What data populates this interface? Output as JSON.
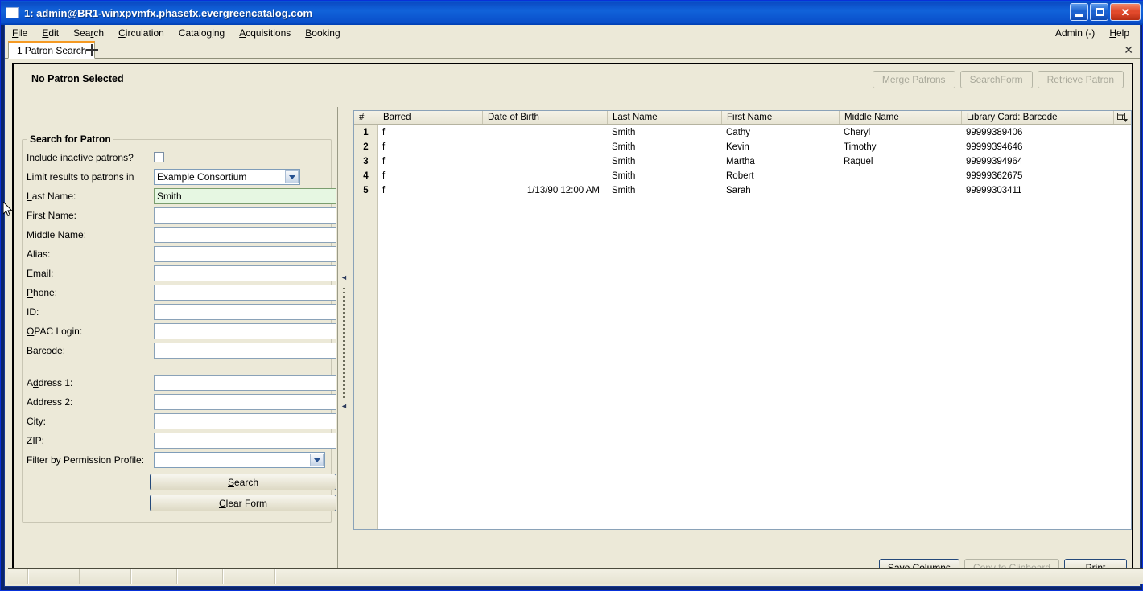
{
  "window": {
    "title": "1: admin@BR1-winxpvmfx.phasefx.evergreencatalog.com",
    "minimize_label": "Minimize",
    "maximize_label": "Maximize",
    "close_label": "✕"
  },
  "menubar": {
    "items": [
      {
        "label": "File",
        "accel": "F"
      },
      {
        "label": "Edit",
        "accel": "E"
      },
      {
        "label": "Search",
        "accel": "r"
      },
      {
        "label": "Circulation",
        "accel": "C"
      },
      {
        "label": "Cataloging",
        "accel": "g"
      },
      {
        "label": "Acquisitions",
        "accel": "A"
      },
      {
        "label": "Booking",
        "accel": "B"
      }
    ],
    "right_items": [
      {
        "label": "Admin (-)"
      },
      {
        "label": "Help"
      }
    ]
  },
  "tabs": {
    "active": {
      "number": "1",
      "label": "Patron Search"
    },
    "add_label": "+",
    "close_label": "✕"
  },
  "patron_header": {
    "status": "No Patron Selected",
    "buttons": [
      {
        "label": "Merge Patrons",
        "enabled": false
      },
      {
        "label": "Search Form",
        "enabled": false
      },
      {
        "label": "Retrieve Patron",
        "enabled": false
      }
    ]
  },
  "search_form": {
    "legend": "Search for Patron",
    "include_inactive_label": "Include inactive patrons?",
    "include_inactive_checked": false,
    "limit_results_label": "Limit results to patrons in",
    "limit_results_value": "Example Consortium",
    "fields": [
      {
        "label": "Last Name:",
        "value": "Smith",
        "focused": true
      },
      {
        "label": "First Name:",
        "value": "",
        "focused": false
      },
      {
        "label": "Middle Name:",
        "value": "",
        "focused": false
      },
      {
        "label": "Alias:",
        "value": "",
        "focused": false
      },
      {
        "label": "Email:",
        "value": "",
        "focused": false
      },
      {
        "label": "Phone:",
        "value": "",
        "focused": false
      },
      {
        "label": "ID:",
        "value": "",
        "focused": false
      },
      {
        "label": "OPAC Login:",
        "value": "",
        "focused": false
      },
      {
        "label": "Barcode:",
        "value": "",
        "focused": false
      }
    ],
    "address_fields": [
      {
        "label": "Address 1:",
        "value": ""
      },
      {
        "label": "Address 2:",
        "value": ""
      },
      {
        "label": "City:",
        "value": ""
      },
      {
        "label": "ZIP:",
        "value": ""
      }
    ],
    "permission_profile_label": "Filter by Permission Profile:",
    "permission_profile_value": "",
    "search_button": "Search",
    "clear_button": "Clear Form"
  },
  "results": {
    "columns": [
      {
        "key": "num",
        "label": "#"
      },
      {
        "key": "barred",
        "label": "Barred"
      },
      {
        "key": "dob",
        "label": "Date of Birth"
      },
      {
        "key": "last",
        "label": "Last Name"
      },
      {
        "key": "first",
        "label": "First Name"
      },
      {
        "key": "middle",
        "label": "Middle Name"
      },
      {
        "key": "barcode",
        "label": "Library Card: Barcode"
      }
    ],
    "rows": [
      {
        "num": "1",
        "barred": "f",
        "dob": "",
        "last": "Smith",
        "first": "Cathy",
        "middle": "Cheryl",
        "barcode": "99999389406"
      },
      {
        "num": "2",
        "barred": "f",
        "dob": "",
        "last": "Smith",
        "first": "Kevin",
        "middle": "Timothy",
        "barcode": "99999394646"
      },
      {
        "num": "3",
        "barred": "f",
        "dob": "",
        "last": "Smith",
        "first": "Martha",
        "middle": "Raquel",
        "barcode": "99999394964"
      },
      {
        "num": "4",
        "barred": "f",
        "dob": "",
        "last": "Smith",
        "first": "Robert",
        "middle": "",
        "barcode": "99999362675"
      },
      {
        "num": "5",
        "barred": "f",
        "dob": "1/13/90 12:00 AM",
        "last": "Smith",
        "first": "Sarah",
        "middle": "",
        "barcode": "99999303411"
      }
    ],
    "column_picker_icon": "column-picker-icon",
    "buttons": [
      {
        "label": "Save Columns",
        "enabled": true
      },
      {
        "label": "Copy to Clipboard",
        "enabled": false
      },
      {
        "label": "Print",
        "enabled": true
      }
    ]
  },
  "statusbar": {
    "cells": [
      "",
      "",
      "",
      "",
      "",
      "",
      ""
    ]
  },
  "colors": {
    "title_blue": "#0a4bc4",
    "window_bg": "#ece9d8",
    "tab_accent": "#f59a23",
    "focused_field": "#e6f7e2",
    "field_border": "#8aa2b8"
  }
}
